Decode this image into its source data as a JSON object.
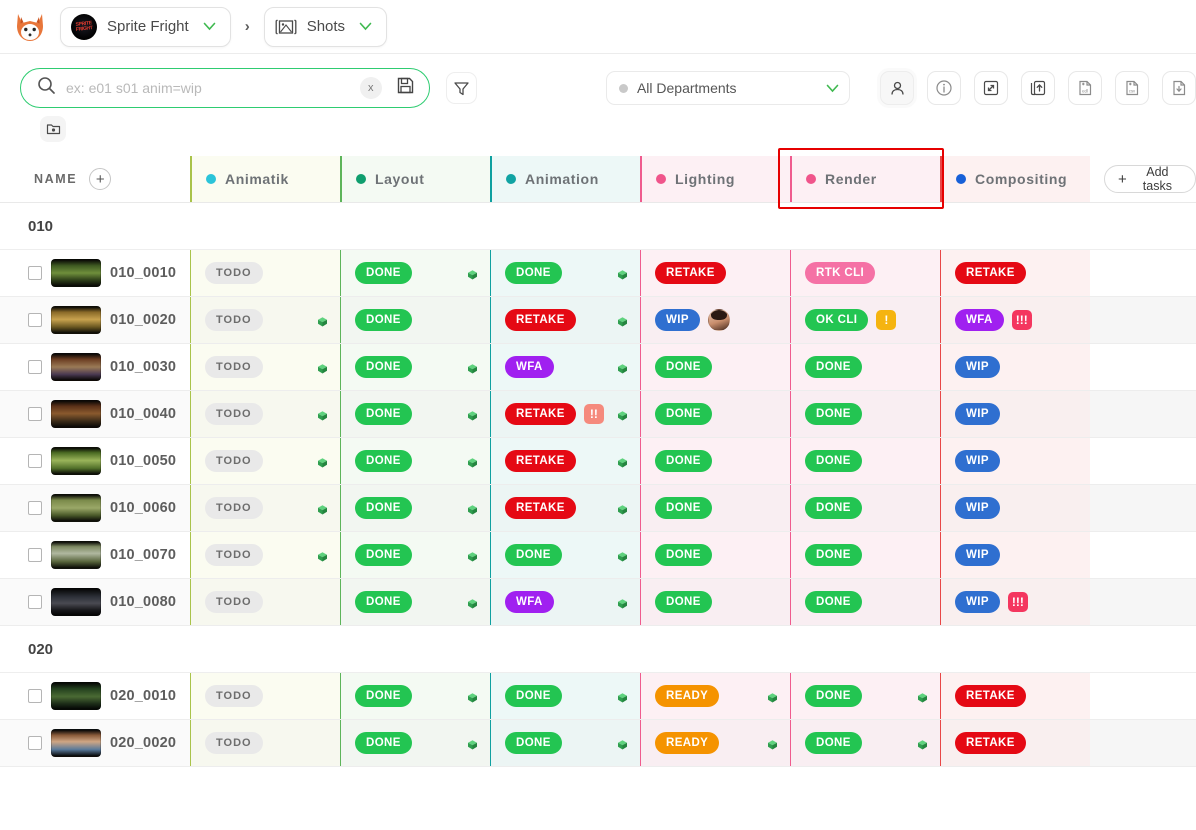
{
  "topbar": {
    "logo": "fox-logo",
    "project": "Sprite Fright",
    "separator": "›",
    "section": "Shots"
  },
  "toolbar": {
    "search_placeholder": "ex: e01 s01 anim=wip",
    "search_value": "",
    "clear_label": "x",
    "save_search_icon": "floppy-save-icon",
    "filter_icon": "funnel-filter-icon",
    "department_dot_color": "#c9c9c9",
    "department_label": "All Departments",
    "icons": [
      "person-assign-icon",
      "info-circle-icon",
      "expand-arrows-icon",
      "share-upload-icon",
      "export-edl-icon",
      "export-csv-icon",
      "download-file-icon"
    ],
    "folder_icon": "folder-add-icon"
  },
  "table": {
    "name_header": "NAME",
    "add_column_label": "+",
    "add_tasks_label": "Add tasks",
    "add_tasks_icon": "plus-icon",
    "columns": [
      {
        "label": "Animatik",
        "dot": "#2bc4d9",
        "bg": "#fbfcf1",
        "border": "#a9c34a"
      },
      {
        "label": "Layout",
        "dot": "#0f9e6e",
        "bg": "#f4faf3",
        "border": "#5db45a"
      },
      {
        "label": "Animation",
        "dot": "#11a3a3",
        "bg": "#edf8f7",
        "border": "#0fa0a0"
      },
      {
        "label": "Lighting",
        "dot": "#f0558b",
        "bg": "#fdf0f4",
        "border": "#ef5b8e"
      },
      {
        "label": "Render",
        "dot": "#f0558b",
        "bg": "#fdf0f4",
        "border": "#ef5b8e"
      },
      {
        "label": "Compositing",
        "dot": "#1760d8",
        "bg": "#fdf1f1",
        "border": "#e84747"
      }
    ],
    "groups": [
      {
        "name": "010",
        "rows": [
          {
            "shot": "010_0010",
            "thumb": "shot-thumbnail",
            "cells": [
              {
                "status": "TODO",
                "type": "todo",
                "gem": false
              },
              {
                "status": "DONE",
                "type": "done",
                "gem": true
              },
              {
                "status": "DONE",
                "type": "done",
                "gem": true
              },
              {
                "status": "RETAKE",
                "type": "retake",
                "gem": false
              },
              {
                "status": "RTK CLI",
                "type": "rtkcli",
                "gem": false
              },
              {
                "status": "RETAKE",
                "type": "retake",
                "gem": false
              }
            ]
          },
          {
            "shot": "010_0020",
            "thumb": "shot-thumbnail",
            "cells": [
              {
                "status": "TODO",
                "type": "todo",
                "gem": true
              },
              {
                "status": "DONE",
                "type": "done",
                "gem": false
              },
              {
                "status": "RETAKE",
                "type": "retake",
                "gem": true
              },
              {
                "status": "WIP",
                "type": "wip",
                "gem": false,
                "avatar": true
              },
              {
                "status": "OK CLI",
                "type": "okcli",
                "gem": false,
                "prio": "!",
                "prio_color": "#f5b410"
              },
              {
                "status": "WFA",
                "type": "wfa",
                "gem": false,
                "prio": "!!!",
                "prio_color": "#f4365f"
              }
            ]
          },
          {
            "shot": "010_0030",
            "thumb": "shot-thumbnail",
            "cells": [
              {
                "status": "TODO",
                "type": "todo",
                "gem": true
              },
              {
                "status": "DONE",
                "type": "done",
                "gem": true
              },
              {
                "status": "WFA",
                "type": "wfa",
                "gem": true
              },
              {
                "status": "DONE",
                "type": "done",
                "gem": false
              },
              {
                "status": "DONE",
                "type": "done",
                "gem": false
              },
              {
                "status": "WIP",
                "type": "wip",
                "gem": false
              }
            ]
          },
          {
            "shot": "010_0040",
            "thumb": "shot-thumbnail",
            "cells": [
              {
                "status": "TODO",
                "type": "todo",
                "gem": true
              },
              {
                "status": "DONE",
                "type": "done",
                "gem": true
              },
              {
                "status": "RETAKE",
                "type": "retake",
                "gem": true,
                "prio": "!!",
                "prio_color": "#f58a7d"
              },
              {
                "status": "DONE",
                "type": "done",
                "gem": false
              },
              {
                "status": "DONE",
                "type": "done",
                "gem": false
              },
              {
                "status": "WIP",
                "type": "wip",
                "gem": false
              }
            ]
          },
          {
            "shot": "010_0050",
            "thumb": "shot-thumbnail",
            "cells": [
              {
                "status": "TODO",
                "type": "todo",
                "gem": true
              },
              {
                "status": "DONE",
                "type": "done",
                "gem": true
              },
              {
                "status": "RETAKE",
                "type": "retake",
                "gem": true
              },
              {
                "status": "DONE",
                "type": "done",
                "gem": false
              },
              {
                "status": "DONE",
                "type": "done",
                "gem": false
              },
              {
                "status": "WIP",
                "type": "wip",
                "gem": false
              }
            ]
          },
          {
            "shot": "010_0060",
            "thumb": "shot-thumbnail",
            "cells": [
              {
                "status": "TODO",
                "type": "todo",
                "gem": true
              },
              {
                "status": "DONE",
                "type": "done",
                "gem": true
              },
              {
                "status": "RETAKE",
                "type": "retake",
                "gem": true
              },
              {
                "status": "DONE",
                "type": "done",
                "gem": false
              },
              {
                "status": "DONE",
                "type": "done",
                "gem": false
              },
              {
                "status": "WIP",
                "type": "wip",
                "gem": false
              }
            ]
          },
          {
            "shot": "010_0070",
            "thumb": "shot-thumbnail",
            "cells": [
              {
                "status": "TODO",
                "type": "todo",
                "gem": true
              },
              {
                "status": "DONE",
                "type": "done",
                "gem": true
              },
              {
                "status": "DONE",
                "type": "done",
                "gem": true
              },
              {
                "status": "DONE",
                "type": "done",
                "gem": false
              },
              {
                "status": "DONE",
                "type": "done",
                "gem": false
              },
              {
                "status": "WIP",
                "type": "wip",
                "gem": false
              }
            ]
          },
          {
            "shot": "010_0080",
            "thumb": "shot-thumbnail",
            "cells": [
              {
                "status": "TODO",
                "type": "todo",
                "gem": false
              },
              {
                "status": "DONE",
                "type": "done",
                "gem": true
              },
              {
                "status": "WFA",
                "type": "wfa",
                "gem": true
              },
              {
                "status": "DONE",
                "type": "done",
                "gem": false
              },
              {
                "status": "DONE",
                "type": "done",
                "gem": false
              },
              {
                "status": "WIP",
                "type": "wip",
                "gem": false,
                "prio": "!!!",
                "prio_color": "#f4365f"
              }
            ]
          }
        ]
      },
      {
        "name": "020",
        "rows": [
          {
            "shot": "020_0010",
            "thumb": "shot-thumbnail",
            "cells": [
              {
                "status": "TODO",
                "type": "todo",
                "gem": false
              },
              {
                "status": "DONE",
                "type": "done",
                "gem": true
              },
              {
                "status": "DONE",
                "type": "done",
                "gem": true
              },
              {
                "status": "READY",
                "type": "ready",
                "gem": true
              },
              {
                "status": "DONE",
                "type": "done",
                "gem": true
              },
              {
                "status": "RETAKE",
                "type": "retake",
                "gem": false
              }
            ]
          },
          {
            "shot": "020_0020",
            "thumb": "shot-thumbnail",
            "cells": [
              {
                "status": "TODO",
                "type": "todo",
                "gem": false
              },
              {
                "status": "DONE",
                "type": "done",
                "gem": true
              },
              {
                "status": "DONE",
                "type": "done",
                "gem": true
              },
              {
                "status": "READY",
                "type": "ready",
                "gem": true
              },
              {
                "status": "DONE",
                "type": "done",
                "gem": true
              },
              {
                "status": "RETAKE",
                "type": "retake",
                "gem": false
              }
            ]
          }
        ]
      }
    ]
  },
  "status_colors": {
    "todo": "#e9e9e9",
    "done": "#23c552",
    "retake": "#e50914",
    "wip": "#2f6fd0",
    "wfa": "#a020f0",
    "ready": "#f59300",
    "rtkcli": "#f571a5",
    "okcli": "#23c552"
  },
  "highlight": {
    "target": "Render",
    "color": "#e60000"
  }
}
